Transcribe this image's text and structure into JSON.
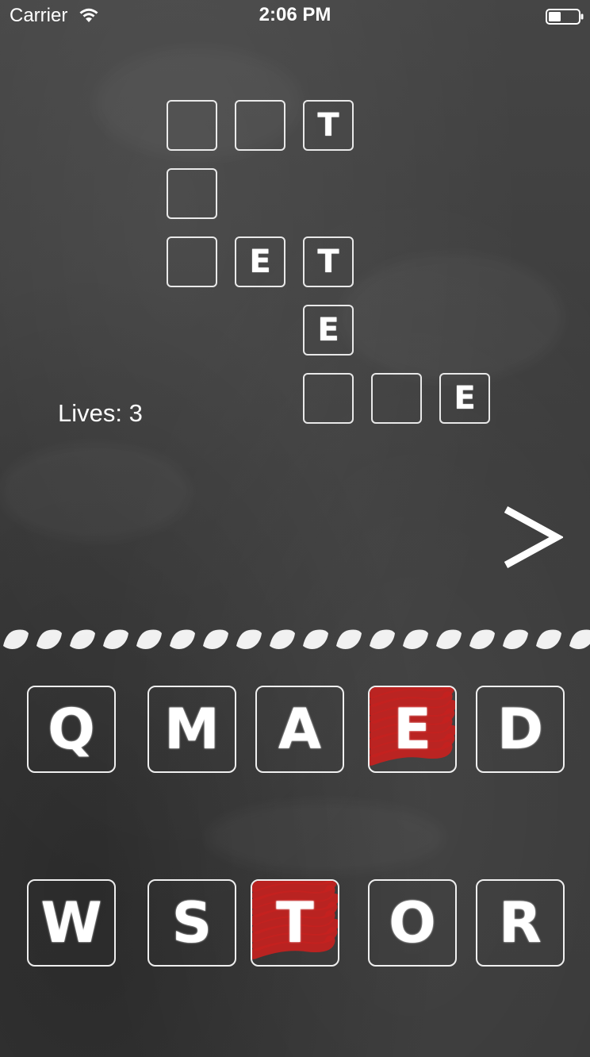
{
  "status_bar": {
    "carrier": "Carrier",
    "time": "2:06 PM",
    "icons": [
      "wifi-icon",
      "battery-icon"
    ]
  },
  "crossword": {
    "cells": [
      {
        "id": "r0c0",
        "letter": ""
      },
      {
        "id": "r0c1",
        "letter": ""
      },
      {
        "id": "r0c2",
        "letter": "T"
      },
      {
        "id": "r1c0",
        "letter": ""
      },
      {
        "id": "r2c0",
        "letter": ""
      },
      {
        "id": "r2c1",
        "letter": "E"
      },
      {
        "id": "r2c2",
        "letter": "T"
      },
      {
        "id": "r3c2",
        "letter": "E"
      },
      {
        "id": "r4c2",
        "letter": ""
      },
      {
        "id": "r4c3",
        "letter": ""
      },
      {
        "id": "r4c4",
        "letter": "E"
      }
    ]
  },
  "lives": {
    "label": "Lives: 3"
  },
  "next_button": {
    "icon": "chevron-right-icon"
  },
  "letter_tiles": {
    "row1": [
      {
        "letter": "Q",
        "used": false
      },
      {
        "letter": "M",
        "used": false
      },
      {
        "letter": "A",
        "used": false
      },
      {
        "letter": "E",
        "used": true
      },
      {
        "letter": "D",
        "used": false
      }
    ],
    "row2": [
      {
        "letter": "W",
        "used": false
      },
      {
        "letter": "S",
        "used": false
      },
      {
        "letter": "T",
        "used": true
      },
      {
        "letter": "O",
        "used": false
      },
      {
        "letter": "R",
        "used": false
      }
    ]
  },
  "colors": {
    "background": "#3e3e3e",
    "chalk": "#ffffff",
    "used_mark": "#c4221f"
  }
}
